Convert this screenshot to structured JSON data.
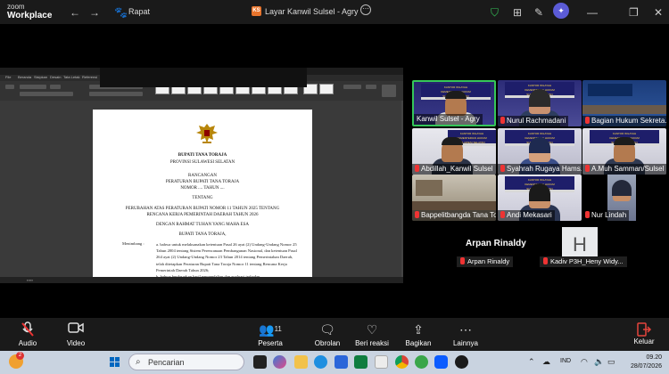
{
  "app": {
    "logo_top": "zoom",
    "logo_bottom": "Workplace"
  },
  "titlebar": {
    "meeting_title": "Rapat",
    "share_tag": "KS",
    "share_title": "Layar Kanwil Sulsel - Agry",
    "more": "⋯",
    "ai": "✦",
    "window_controls": [
      "—",
      "❐",
      "✕"
    ]
  },
  "document": {
    "menu": [
      "File",
      "Beranda",
      "Sisipkan",
      "Desain",
      "Tata Letak",
      "Referensi",
      "Surat",
      "Tinjau",
      "Tampilan",
      "Bantuan"
    ],
    "regent": "BUPATI TANA TORAJA",
    "province": "PROVINSI SULAWESI SELATAN",
    "draft": "RANCANGAN",
    "regulation": "PERATURAN BUPATI TANA TORAJA",
    "number": "NOMOR ....  TAHUN ....",
    "about": "TENTANG",
    "subject1": "PERUBAHAN ATAS PERATURAN BUPATI NOMOR 11 TAHUN 2025 TENTANG",
    "subject2": "RENCANA KERJA PEMERINTAH DAERAH TAHUN 2026",
    "grace": "DENGAN RAHMAT TUHAN YANG MAHA ESA",
    "regent2": "BUPATI TANA TORAJA,",
    "considering": "Menimbang :",
    "point_a": "a. bahwa untuk melaksanakan ketentuan Pasal 26 ayat (2) Undang-Undang Nomor 25 Tahun 2004 tentang Sistem Perencanaan Pembangunan Nasional, dan ketentuan Pasal 264 ayat (2) Undang-Undang Nomor 23 Tahun 2014 tentang Pemerintahan Daerah, telah ditetapkan Peraturan Bupati Tana Toraja Nomor 11 tentang Rencana Kerja Pemerintah Daerah Tahun 2026;",
    "point_b": "b. bahwa berdasarkan hasil pengendalian dan evaluasi terhadap"
  },
  "tiles": [
    {
      "name": "Kanwil Sulsel - Agry",
      "active": true
    },
    {
      "name": "Nurul Rachmadani",
      "active": false
    },
    {
      "name": "Bagian Hukum Sekreta...",
      "active": false
    },
    {
      "name": "Abdillah_Kanwil Sulsel",
      "active": false
    },
    {
      "name": "Syahrah Rugaya Hams...",
      "active": false
    },
    {
      "name": "A.Muh Samman/Sulsel",
      "active": false
    },
    {
      "name": "Bappelitbangda Tana Toraj...",
      "active": false
    },
    {
      "name": "Andi Mekasari",
      "active": false
    },
    {
      "name": "Nur Lindah",
      "active": false
    }
  ],
  "banner_text": [
    "KANTOR WILAYAH",
    "KEMENTERIAN HUKUM",
    "SULAWESI SELATAN"
  ],
  "speaker": {
    "name": "Arpan Rinaldy",
    "label": "Arpan Rinaldy"
  },
  "avatar_tile": {
    "initial": "H",
    "label": "Kadiv P3H_Heny Widy..."
  },
  "toolbar": {
    "audio": "Audio",
    "video": "Video",
    "participants": "Peserta",
    "participants_count": "11",
    "chat": "Obrolan",
    "react": "Beri reaksi",
    "share": "Bagikan",
    "more": "Lainnya",
    "leave": "Keluar"
  },
  "taskbar": {
    "search_placeholder": "Pencarian",
    "lang": "IND",
    "time": "09.20",
    "date": "28/07/2026",
    "badge": "2"
  },
  "colors": {
    "active_border": "#35c759",
    "leave_red": "#e5443c",
    "muted_red": "#e33333"
  }
}
